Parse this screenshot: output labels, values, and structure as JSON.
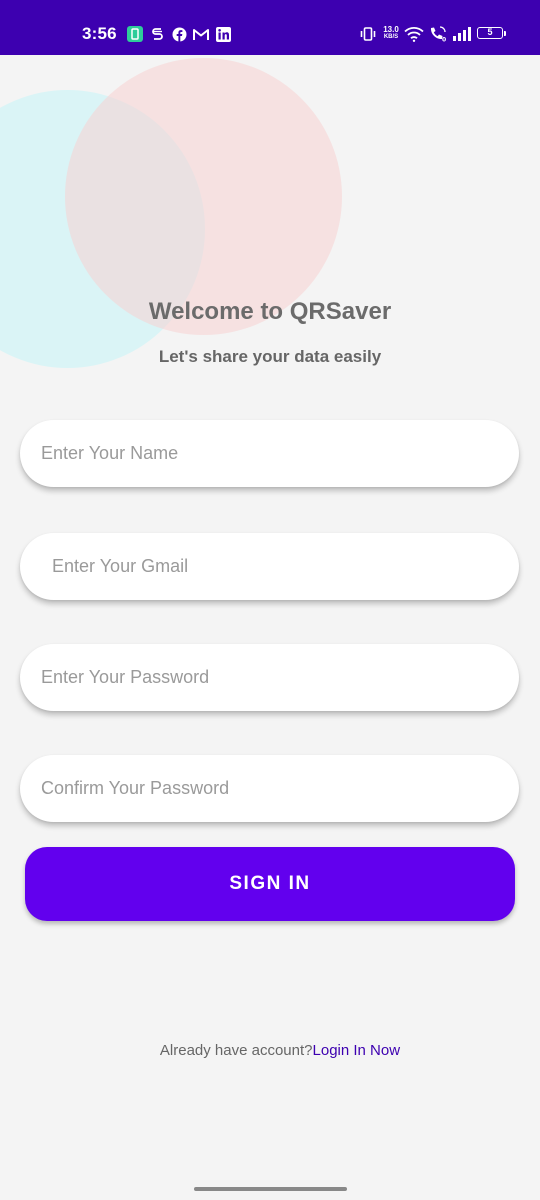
{
  "status_bar": {
    "time": "3:56",
    "net_speed_value": "13.0",
    "net_speed_unit": "KB/S",
    "battery_level": "5",
    "background_color": "#3d00b0",
    "notification_icons": [
      "app-notification-icon",
      "s-app-icon",
      "facebook-icon",
      "gmail-icon",
      "linkedin-icon"
    ],
    "system_icons": [
      "vibrate-icon",
      "wifi-icon",
      "volte-call-icon",
      "signal-icon",
      "battery-icon"
    ]
  },
  "header": {
    "title": "Welcome to QRSaver",
    "subtitle": "Let's share your data easily"
  },
  "form": {
    "name_placeholder": "Enter Your Name",
    "gmail_placeholder": "Enter Your Gmail",
    "password_placeholder": "Enter Your Password",
    "confirm_password_placeholder": "Confirm Your Password",
    "name_value": "",
    "gmail_value": "",
    "password_value": "",
    "confirm_password_value": ""
  },
  "signin_button": {
    "label": "SIGN IN",
    "color": "#6200ee"
  },
  "footer": {
    "prompt": "Already have account?",
    "link": "Login In Now",
    "link_color": "#3d00b0"
  }
}
